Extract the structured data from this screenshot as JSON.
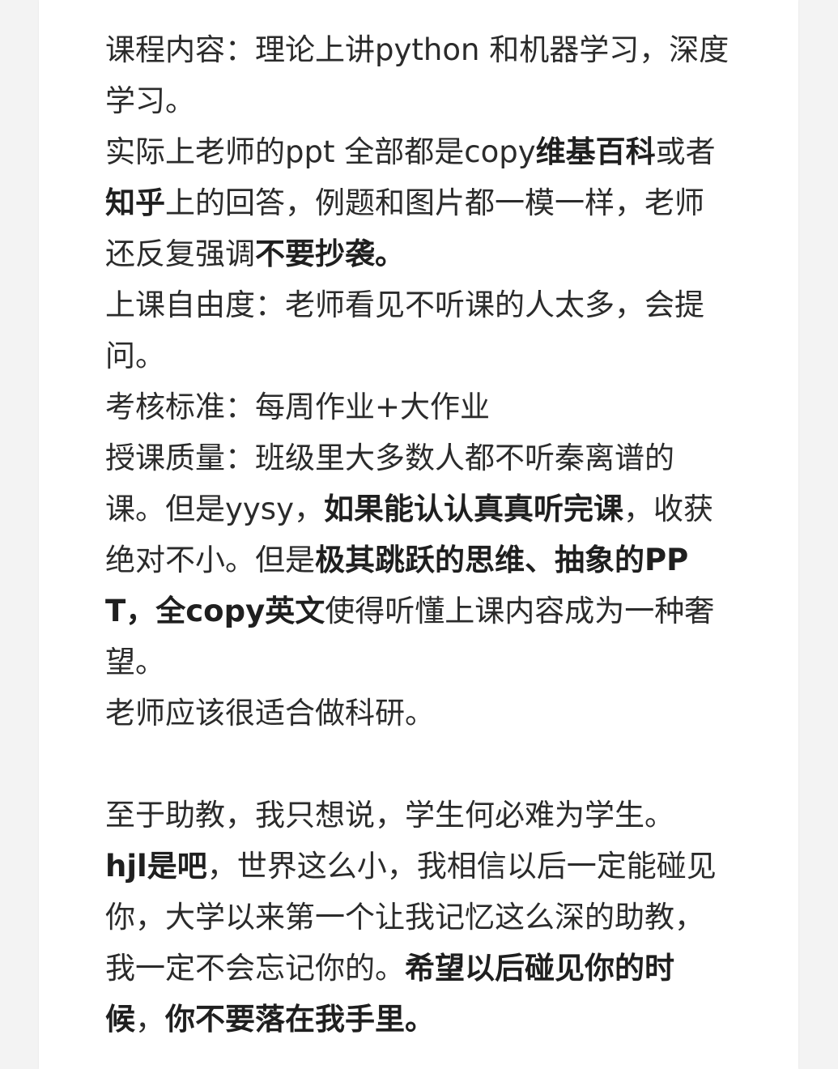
{
  "paragraphs": [
    {
      "runs": [
        {
          "text": "课程内容：理论上讲python 和机器学习，深度学习。",
          "bold": false
        }
      ]
    },
    {
      "runs": [
        {
          "text": "实际上老师的ppt 全部都是copy",
          "bold": false
        },
        {
          "text": "维基百科",
          "bold": true
        },
        {
          "text": "或者",
          "bold": false
        },
        {
          "text": "知乎",
          "bold": true
        },
        {
          "text": "上的回答，例题和图片都一模一样，老师还反复强调",
          "bold": false
        },
        {
          "text": "不要抄袭。",
          "bold": true
        }
      ]
    },
    {
      "runs": [
        {
          "text": "上课自由度：老师看见不听课的人太多，会提问。",
          "bold": false
        }
      ]
    },
    {
      "runs": [
        {
          "text": "考核标准：每周作业+大作业",
          "bold": false
        }
      ]
    },
    {
      "runs": [
        {
          "text": "授课质量：班级里大多数人都不听秦离谱的课。但是yysy，",
          "bold": false
        },
        {
          "text": "如果能认认真真听完课",
          "bold": true
        },
        {
          "text": "，收获绝对不小。但是",
          "bold": false
        },
        {
          "text": "极其跳跃的思维、抽象的PPT，全copy英文",
          "bold": true
        },
        {
          "text": "使得听懂上课内容成为一种奢望。",
          "bold": false
        }
      ]
    },
    {
      "runs": [
        {
          "text": "老师应该很适合做科研。",
          "bold": false
        }
      ]
    },
    {
      "gap": true,
      "runs": []
    },
    {
      "runs": [
        {
          "text": "至于助教，我只想说，学生何必难为学生。",
          "bold": false
        }
      ]
    },
    {
      "runs": [
        {
          "text": "hjl是吧",
          "bold": true
        },
        {
          "text": "，世界这么小，我相信以后一定能碰见你，大学以来第一个让我记忆这么深的助教，我一定不会忘记你的。",
          "bold": false
        },
        {
          "text": "希望以后碰见你的时候",
          "bold": true
        },
        {
          "text": "，",
          "bold": false
        },
        {
          "text": "你不要落在我手里。",
          "bold": true
        }
      ]
    }
  ]
}
